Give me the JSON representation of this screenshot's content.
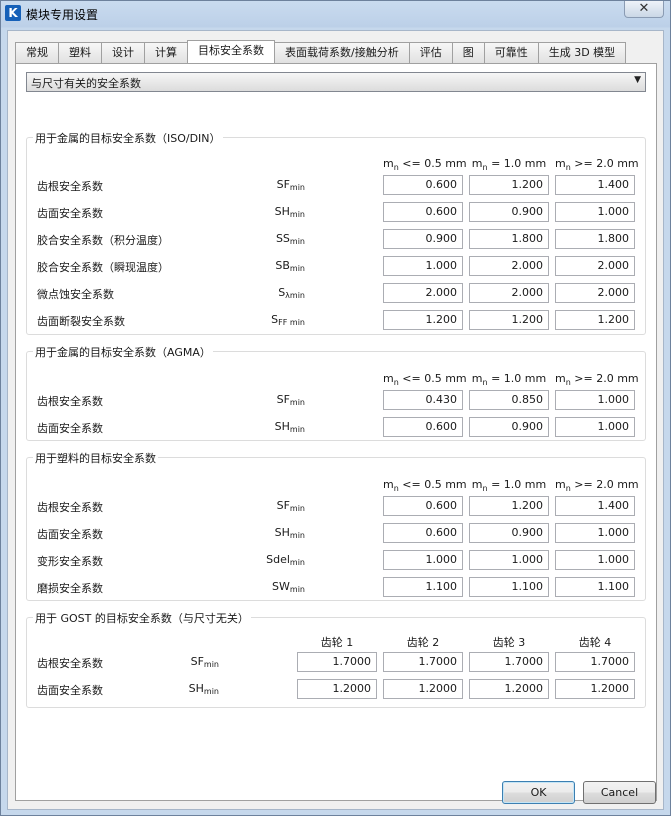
{
  "window": {
    "title": "模块专用设置",
    "app_icon_letter": "K",
    "close_label": "✕"
  },
  "tabs": [
    {
      "label": "常规",
      "active": false
    },
    {
      "label": "塑料",
      "active": false
    },
    {
      "label": "设计",
      "active": false
    },
    {
      "label": "计算",
      "active": false
    },
    {
      "label": "目标安全系数",
      "active": true
    },
    {
      "label": "表面载荷系数/接触分析",
      "active": false
    },
    {
      "label": "评估",
      "active": false
    },
    {
      "label": "图",
      "active": false
    },
    {
      "label": "可靠性",
      "active": false
    },
    {
      "label": "生成 3D 模型",
      "active": false
    }
  ],
  "combo": {
    "value": "与尺寸有关的安全系数",
    "arrow": "▼"
  },
  "groups": {
    "iso": {
      "title": "用于金属的目标安全系数（ISO/DIN）",
      "columns": [
        {
          "base": "m",
          "sub": "n",
          "text": " <= 0.5 mm"
        },
        {
          "base": "m",
          "sub": "n",
          "text": " = 1.0 mm"
        },
        {
          "base": "m",
          "sub": "n",
          "text": " >= 2.0 mm"
        }
      ],
      "rows": [
        {
          "label": "齿根安全系数",
          "sym": "SF",
          "sub": "min",
          "values": [
            "0.600",
            "1.200",
            "1.400"
          ]
        },
        {
          "label": "齿面安全系数",
          "sym": "SH",
          "sub": "min",
          "values": [
            "0.600",
            "0.900",
            "1.000"
          ]
        },
        {
          "label": "胶合安全系数（积分温度）",
          "sym": "SS",
          "sub": "min",
          "values": [
            "0.900",
            "1.800",
            "1.800"
          ]
        },
        {
          "label": "胶合安全系数（瞬现温度）",
          "sym": "SB",
          "sub": "min",
          "values": [
            "1.000",
            "2.000",
            "2.000"
          ]
        },
        {
          "label": "微点蚀安全系数",
          "sym": "S",
          "sub": "λmin",
          "values": [
            "2.000",
            "2.000",
            "2.000"
          ]
        },
        {
          "label": "齿面断裂安全系数",
          "sym": "S",
          "sub": "FF min",
          "values": [
            "1.200",
            "1.200",
            "1.200"
          ]
        }
      ]
    },
    "agma": {
      "title": "用于金属的目标安全系数（AGMA）",
      "columns": [
        {
          "base": "m",
          "sub": "n",
          "text": " <= 0.5 mm"
        },
        {
          "base": "m",
          "sub": "n",
          "text": " = 1.0 mm"
        },
        {
          "base": "m",
          "sub": "n",
          "text": " >= 2.0 mm"
        }
      ],
      "rows": [
        {
          "label": "齿根安全系数",
          "sym": "SF",
          "sub": "min",
          "values": [
            "0.430",
            "0.850",
            "1.000"
          ]
        },
        {
          "label": "齿面安全系数",
          "sym": "SH",
          "sub": "min",
          "values": [
            "0.600",
            "0.900",
            "1.000"
          ]
        }
      ]
    },
    "plastic": {
      "title": "用于塑料的目标安全系数",
      "columns": [
        {
          "base": "m",
          "sub": "n",
          "text": " <= 0.5 mm"
        },
        {
          "base": "m",
          "sub": "n",
          "text": " = 1.0 mm"
        },
        {
          "base": "m",
          "sub": "n",
          "text": " >= 2.0 mm"
        }
      ],
      "rows": [
        {
          "label": "齿根安全系数",
          "sym": "SF",
          "sub": "min",
          "values": [
            "0.600",
            "1.200",
            "1.400"
          ]
        },
        {
          "label": "齿面安全系数",
          "sym": "SH",
          "sub": "min",
          "values": [
            "0.600",
            "0.900",
            "1.000"
          ]
        },
        {
          "label": "变形安全系数",
          "sym": "Sdel",
          "sub": "min",
          "values": [
            "1.000",
            "1.000",
            "1.000"
          ]
        },
        {
          "label": "磨损安全系数",
          "sym": "SW",
          "sub": "min",
          "values": [
            "1.100",
            "1.100",
            "1.100"
          ]
        }
      ]
    },
    "gost": {
      "title": "用于 GOST 的目标安全系数（与尺寸无关）",
      "columns": [
        {
          "base": "齿轮 1",
          "sub": "",
          "text": ""
        },
        {
          "base": "齿轮 2",
          "sub": "",
          "text": ""
        },
        {
          "base": "齿轮 3",
          "sub": "",
          "text": ""
        },
        {
          "base": "齿轮 4",
          "sub": "",
          "text": ""
        }
      ],
      "rows": [
        {
          "label": "齿根安全系数",
          "sym": "SF",
          "sub": "min",
          "values": [
            "1.7000",
            "1.7000",
            "1.7000",
            "1.7000"
          ]
        },
        {
          "label": "齿面安全系数",
          "sym": "SH",
          "sub": "min",
          "values": [
            "1.2000",
            "1.2000",
            "1.2000",
            "1.2000"
          ]
        }
      ]
    }
  },
  "buttons": {
    "ok": "OK",
    "cancel": "Cancel"
  }
}
